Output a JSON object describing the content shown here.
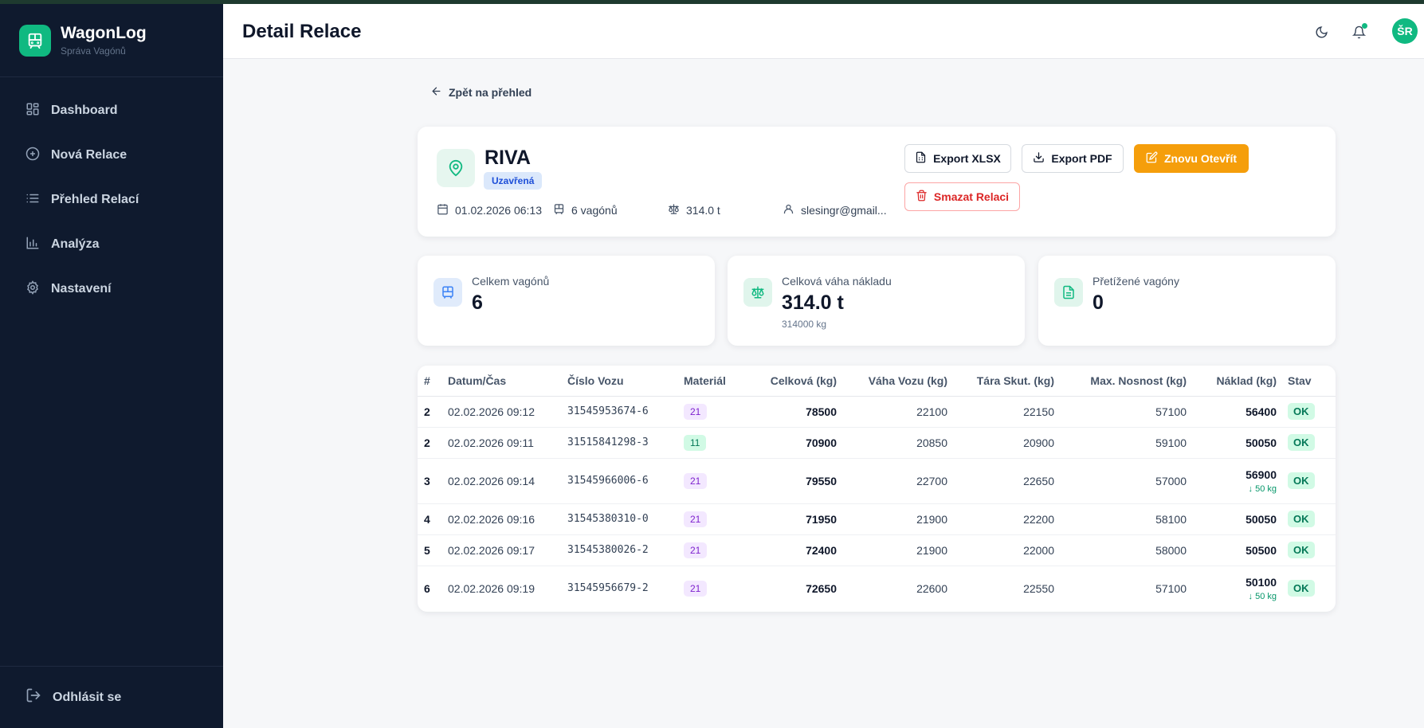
{
  "app": {
    "name": "WagonLog",
    "subtitle": "Správa Vagónů"
  },
  "sidebar": {
    "items": [
      {
        "label": "Dashboard",
        "icon": "dashboard-icon"
      },
      {
        "label": "Nová Relace",
        "icon": "plus-circle-icon"
      },
      {
        "label": "Přehled Relací",
        "icon": "list-icon"
      },
      {
        "label": "Analýza",
        "icon": "bar-chart-icon"
      },
      {
        "label": "Nastavení",
        "icon": "gear-icon"
      }
    ],
    "logout_label": "Odhlásit se"
  },
  "header": {
    "title": "Detail Relace",
    "avatar_initials": "ŠR"
  },
  "back_link": "Zpět na přehled",
  "relation": {
    "name": "RIVA",
    "status": "Uzavřená",
    "datetime": "01.02.2026 06:13",
    "wagons": "6 vagónů",
    "weight": "314.0 t",
    "user": "slesingr@gmail..."
  },
  "actions": {
    "export_xlsx": "Export XLSX",
    "export_pdf": "Export PDF",
    "reopen": "Znovu Otevřít",
    "delete": "Smazat Relaci"
  },
  "stats": [
    {
      "label": "Celkem vagónů",
      "value": "6",
      "sub": ""
    },
    {
      "label": "Celková váha nákladu",
      "value": "314.0 t",
      "sub": "314000 kg"
    },
    {
      "label": "Přetížené vagóny",
      "value": "0",
      "sub": ""
    }
  ],
  "table": {
    "headers": [
      "#",
      "Datum/Čas",
      "Číslo Vozu",
      "Materiál",
      "Celková (kg)",
      "Váha Vozu (kg)",
      "Tára Skut. (kg)",
      "Max. Nosnost (kg)",
      "Náklad (kg)",
      "Stav"
    ],
    "rows": [
      {
        "n": "2",
        "dt": "02.02.2026 09:12",
        "car": "31545953674-6",
        "mat": "21",
        "total": "78500",
        "wagon": "22100",
        "tare": "22150",
        "max": "57100",
        "load": "56400",
        "delta": "",
        "status": "OK"
      },
      {
        "n": "2",
        "dt": "02.02.2026 09:11",
        "car": "31515841298-3",
        "mat": "11",
        "total": "70900",
        "wagon": "20850",
        "tare": "20900",
        "max": "59100",
        "load": "50050",
        "delta": "",
        "status": "OK"
      },
      {
        "n": "3",
        "dt": "02.02.2026 09:14",
        "car": "31545966006-6",
        "mat": "21",
        "total": "79550",
        "wagon": "22700",
        "tare": "22650",
        "max": "57000",
        "load": "56900",
        "delta": "↓ 50 kg",
        "status": "OK"
      },
      {
        "n": "4",
        "dt": "02.02.2026 09:16",
        "car": "31545380310-0",
        "mat": "21",
        "total": "71950",
        "wagon": "21900",
        "tare": "22200",
        "max": "58100",
        "load": "50050",
        "delta": "",
        "status": "OK"
      },
      {
        "n": "5",
        "dt": "02.02.2026 09:17",
        "car": "31545380026-2",
        "mat": "21",
        "total": "72400",
        "wagon": "21900",
        "tare": "22000",
        "max": "58000",
        "load": "50500",
        "delta": "",
        "status": "OK"
      },
      {
        "n": "6",
        "dt": "02.02.2026 09:19",
        "car": "31545956679-2",
        "mat": "21",
        "total": "72650",
        "wagon": "22600",
        "tare": "22550",
        "max": "57100",
        "load": "50100",
        "delta": "↓ 50 kg",
        "status": "OK"
      }
    ]
  },
  "colors": {
    "accent": "#10b981",
    "sidebar_bg": "#0f1a2e",
    "orange": "#f59e0b",
    "danger": "#dc2626"
  }
}
